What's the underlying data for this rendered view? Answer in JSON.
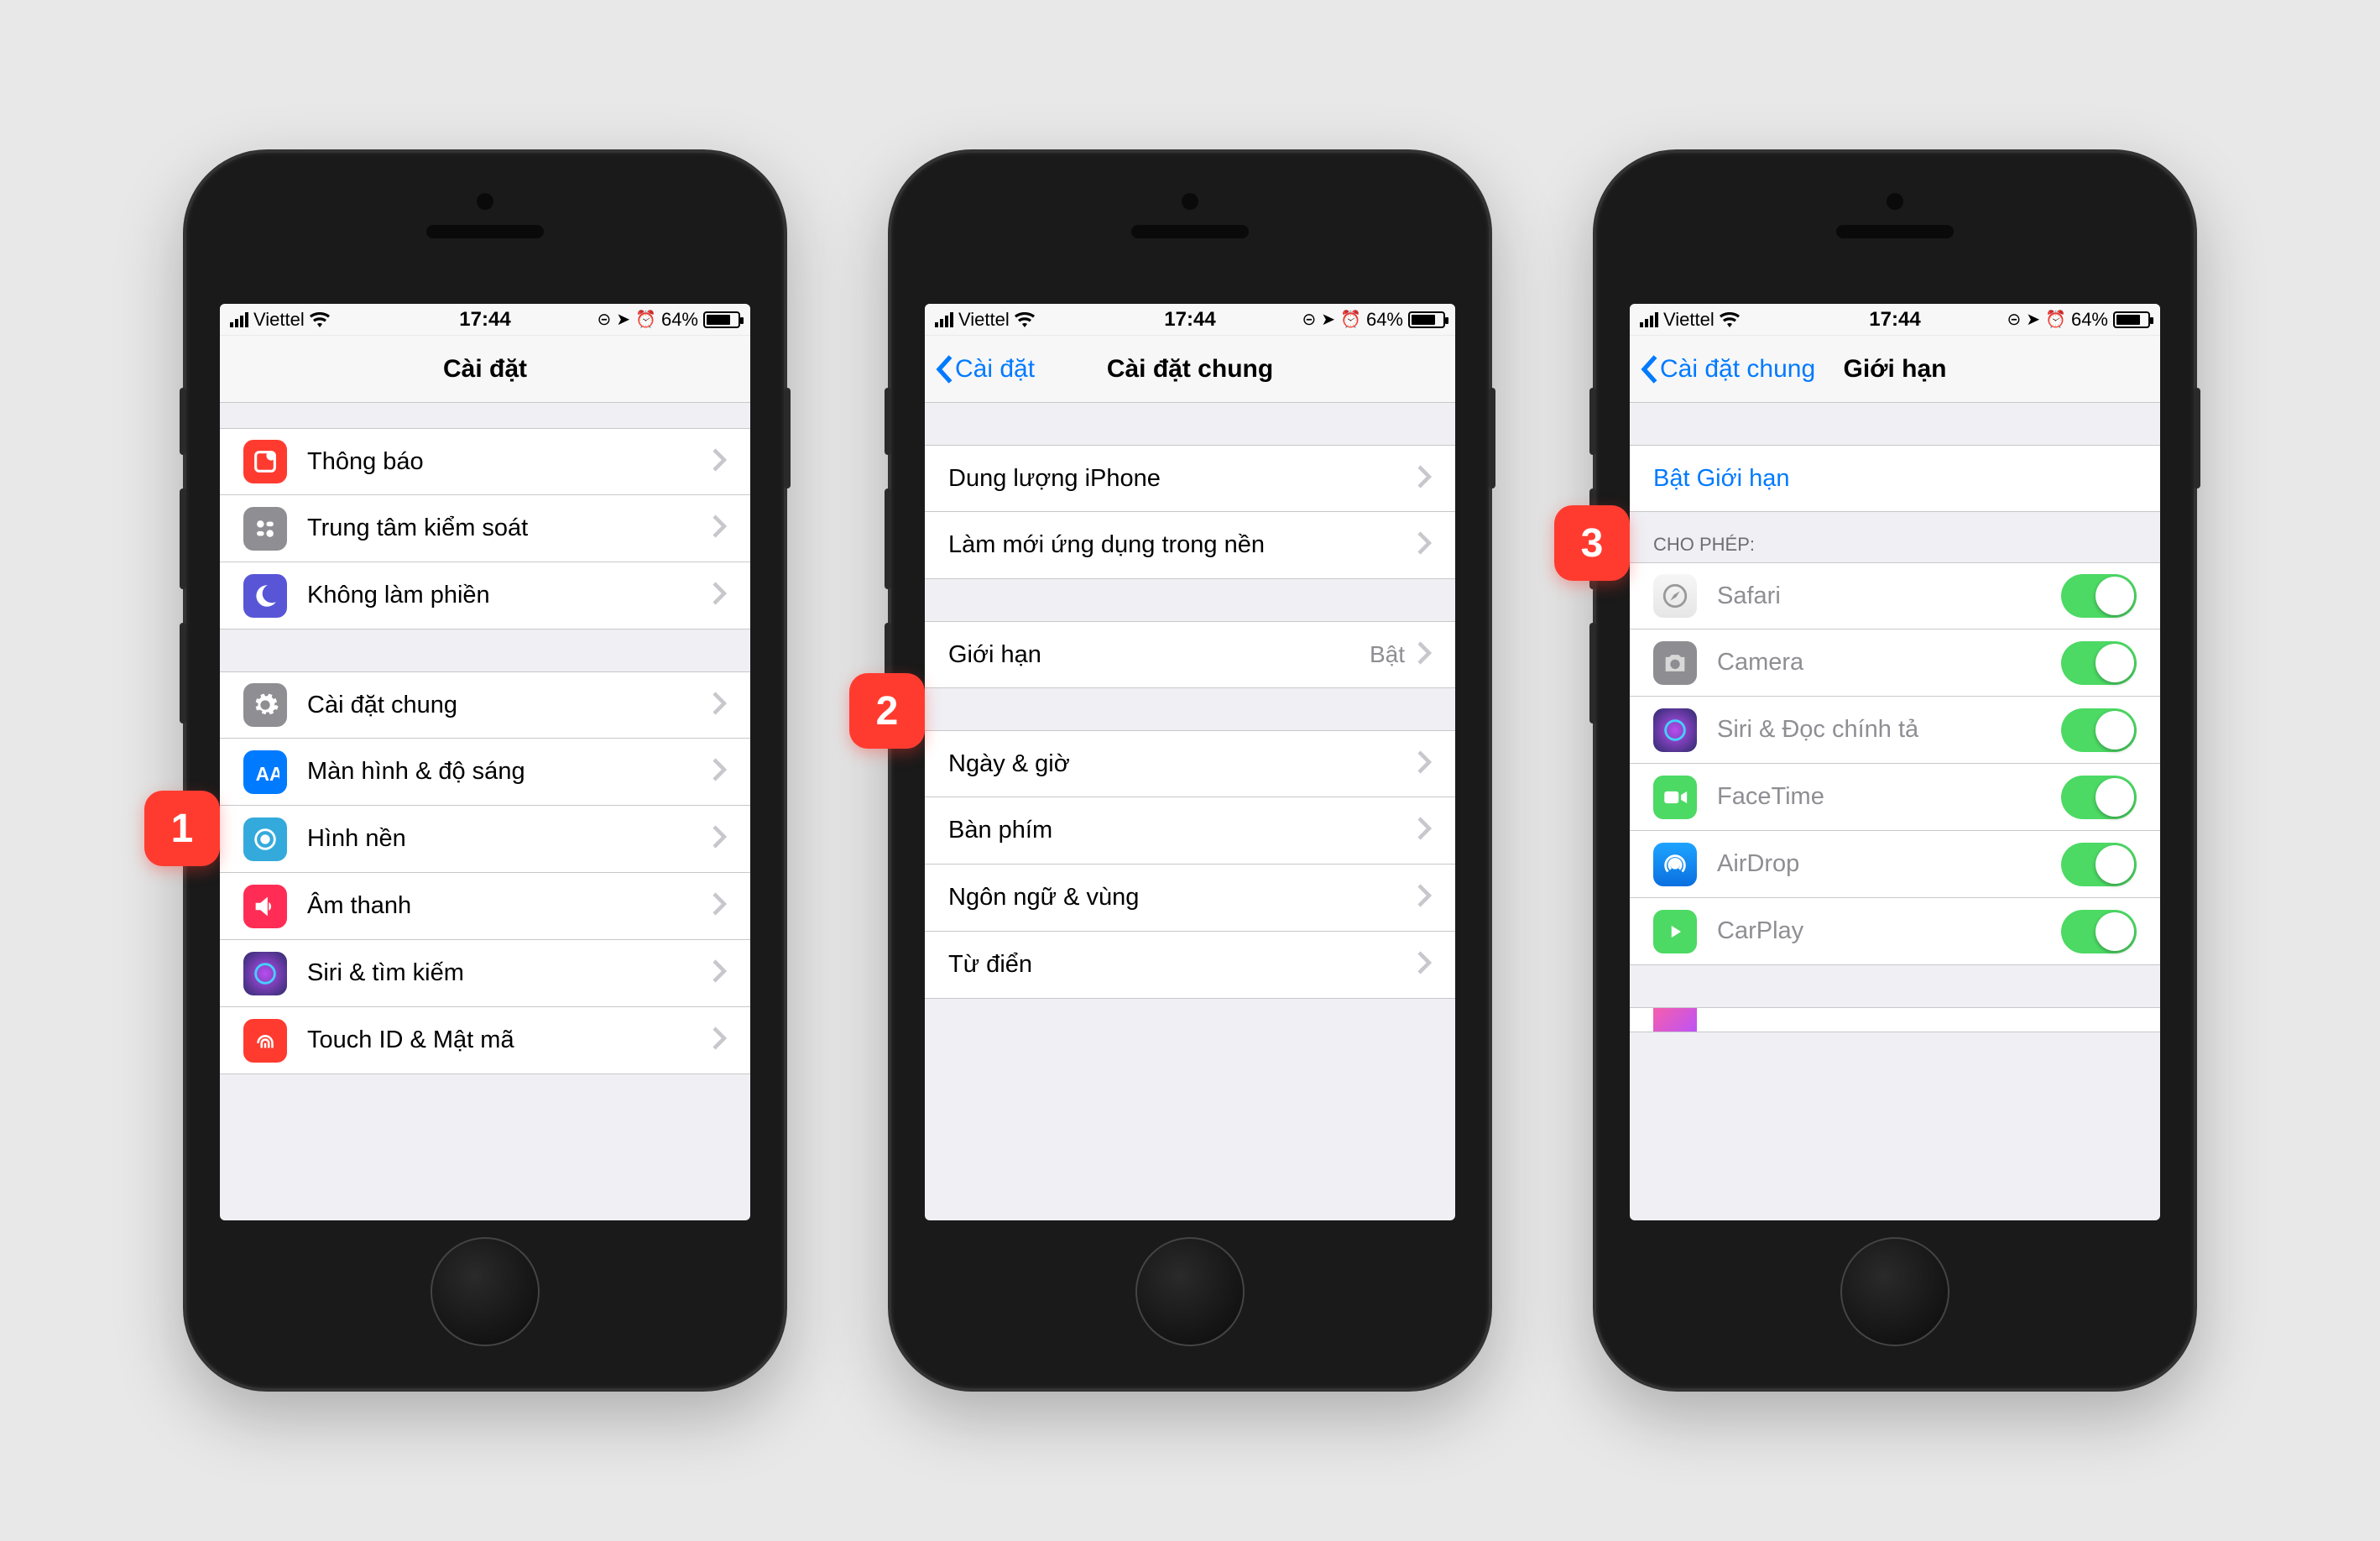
{
  "status": {
    "carrier": "Viettel",
    "time": "17:44",
    "battery_pct": "64%"
  },
  "badges": {
    "b1": "1",
    "b2": "2",
    "b3": "3"
  },
  "phone1": {
    "nav_title": "Cài đặt",
    "rows": {
      "notifications": "Thông báo",
      "control_center": "Trung tâm kiểm soát",
      "dnd": "Không làm phiền",
      "general": "Cài đặt chung",
      "display": "Màn hình & độ sáng",
      "wallpaper": "Hình nền",
      "sound": "Âm thanh",
      "siri": "Siri & tìm kiếm",
      "touchid": "Touch ID & Mật mã"
    }
  },
  "phone2": {
    "nav_back": "Cài đặt",
    "nav_title": "Cài đặt chung",
    "rows": {
      "storage": "Dung lượng iPhone",
      "bg_refresh": "Làm mới ứng dụng trong nền",
      "restrictions": "Giới hạn",
      "restrictions_value": "Bật",
      "datetime": "Ngày & giờ",
      "keyboard": "Bàn phím",
      "lang": "Ngôn ngữ & vùng",
      "dictionary": "Từ điển"
    }
  },
  "phone3": {
    "nav_back": "Cài đặt chung",
    "nav_title": "Giới hạn",
    "enable": "Bật Giới hạn",
    "section_allow": "CHO PHÉP:",
    "rows": {
      "safari": "Safari",
      "camera": "Camera",
      "siri": "Siri & Đọc chính tả",
      "facetime": "FaceTime",
      "airdrop": "AirDrop",
      "carplay": "CarPlay"
    }
  }
}
